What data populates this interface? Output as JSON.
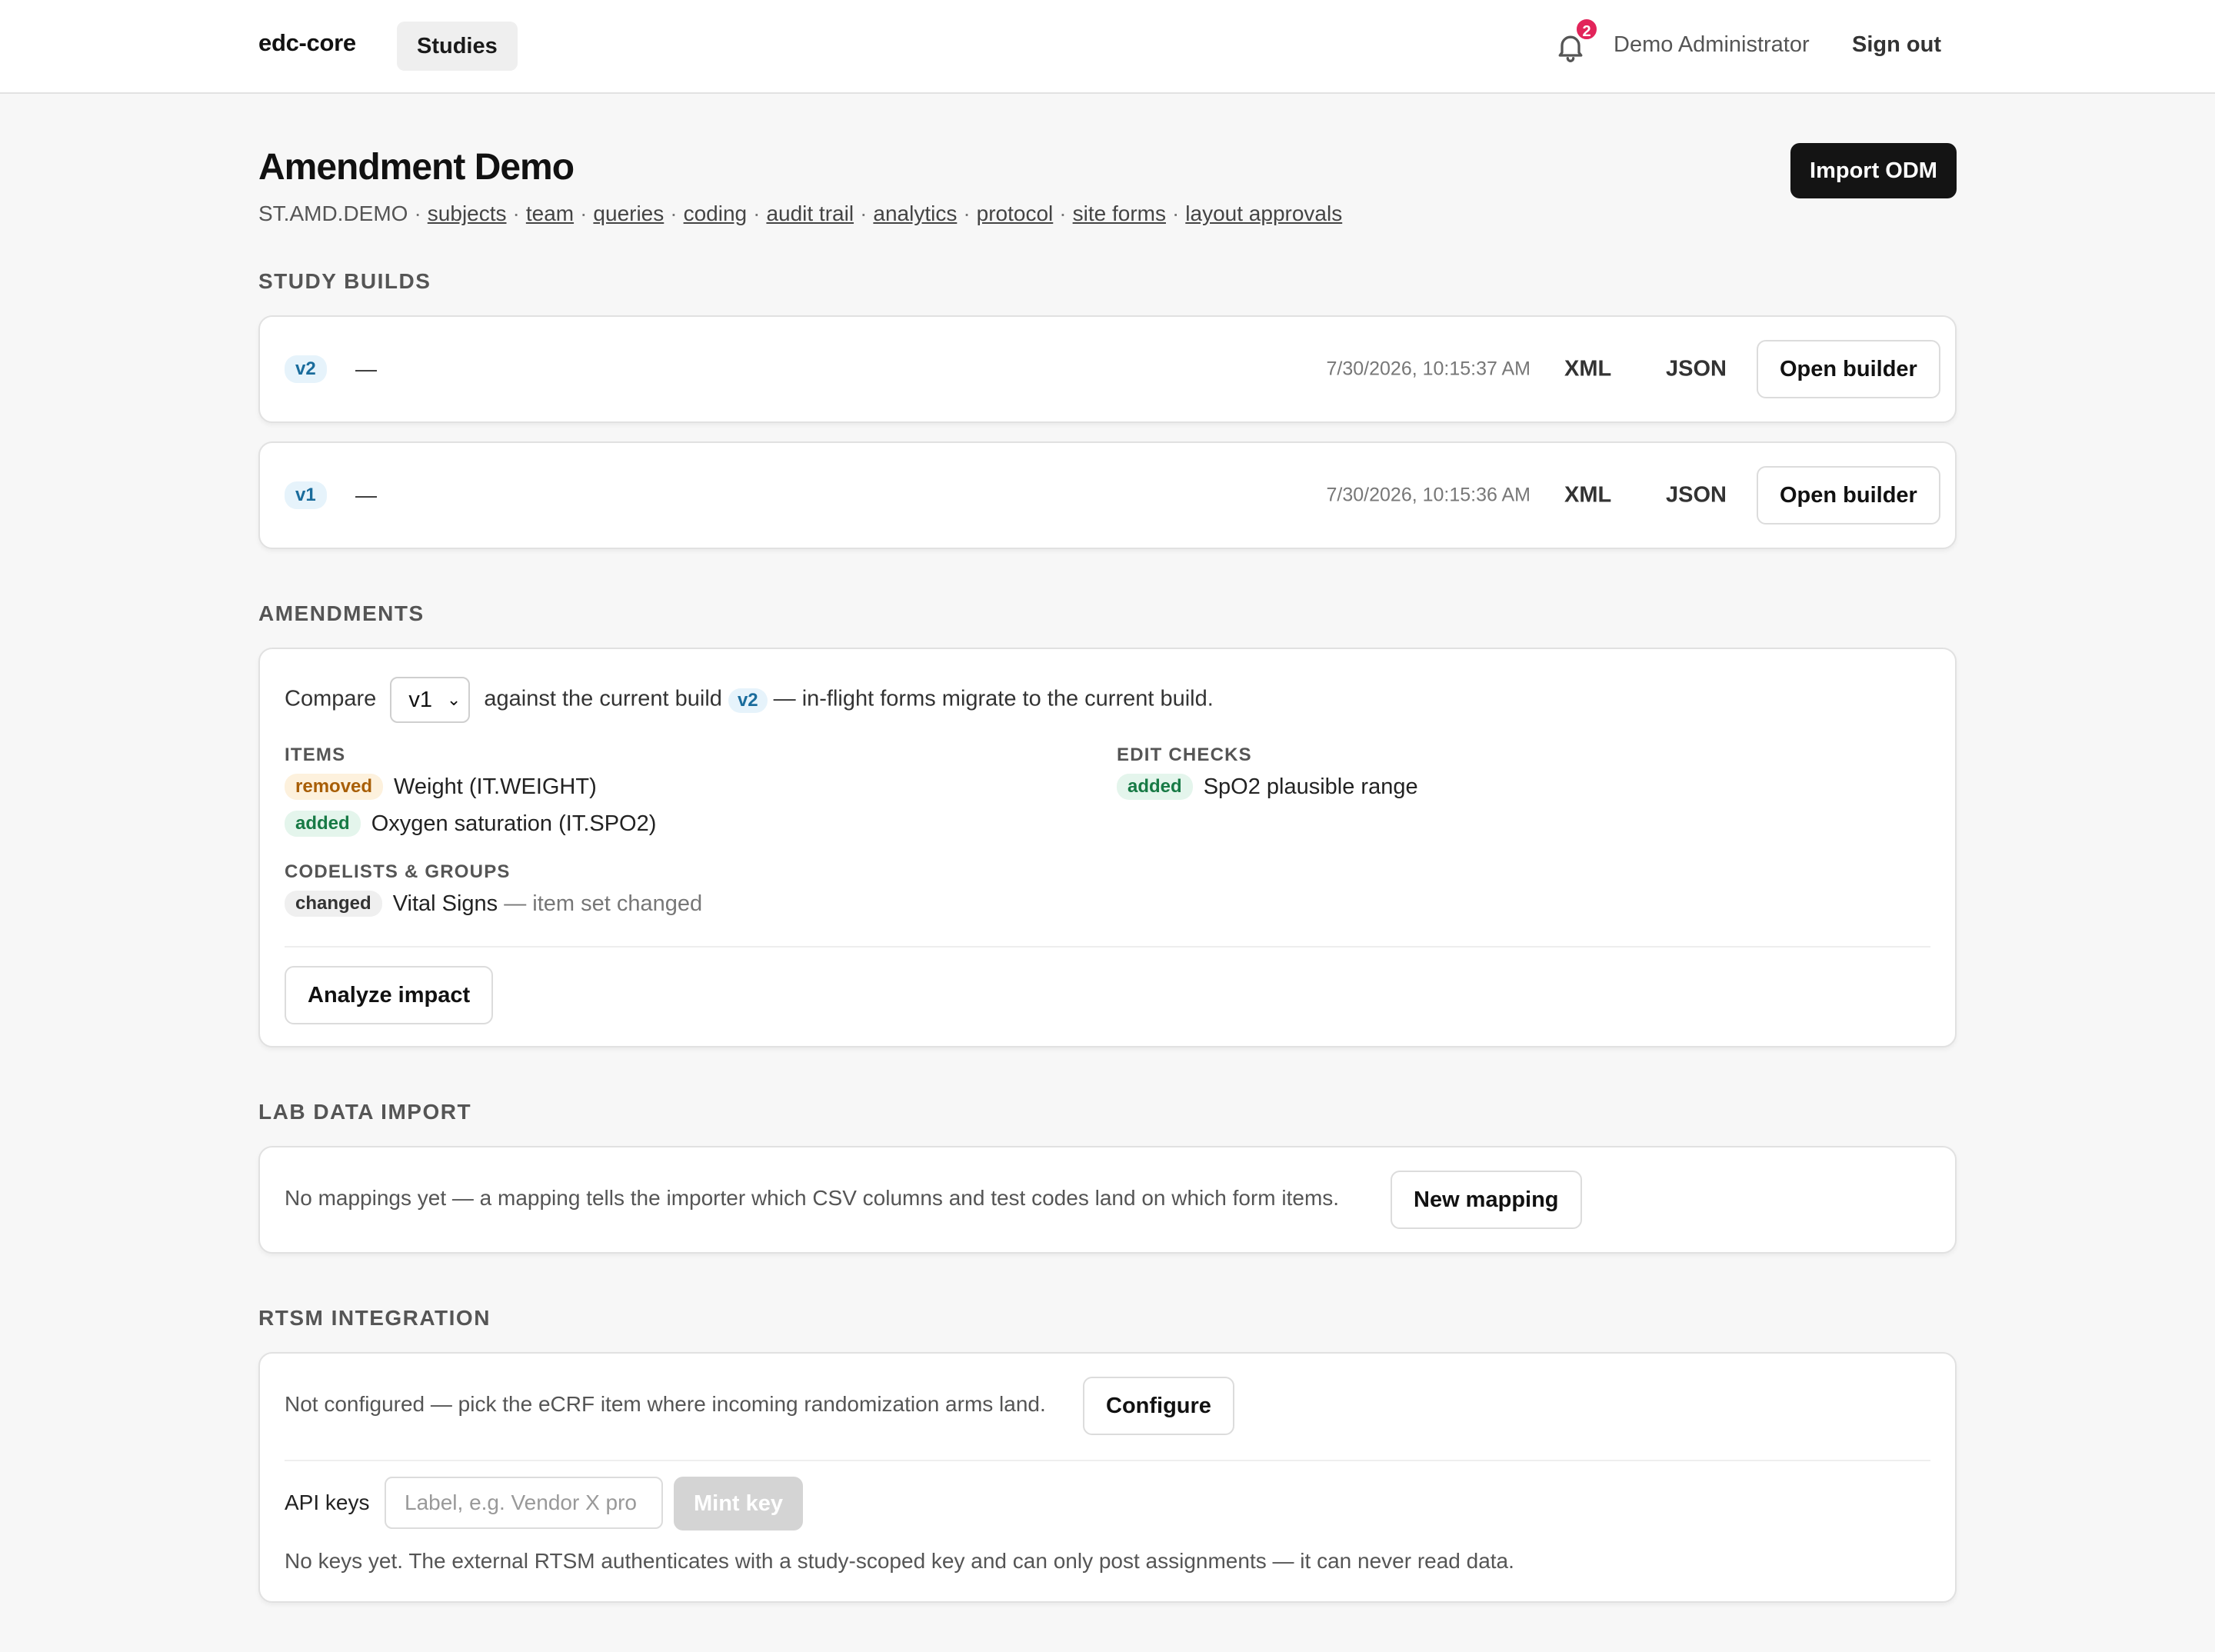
{
  "topbar": {
    "brand": "edc-core",
    "nav_studies": "Studies",
    "notification_count": "2",
    "user_name": "Demo Administrator",
    "sign_out": "Sign out"
  },
  "study": {
    "title": "Amendment Demo",
    "code": "ST.AMD.DEMO",
    "links": [
      "subjects",
      "team",
      "queries",
      "coding",
      "audit trail",
      "analytics",
      "protocol",
      "site forms",
      "layout approvals"
    ],
    "import_button": "Import ODM"
  },
  "builds": {
    "section_title": "STUDY BUILDS",
    "rows": [
      {
        "version": "v2",
        "description": "—",
        "timestamp": "7/30/2026, 10:15:37 AM",
        "xml": "XML",
        "json": "JSON",
        "open": "Open builder"
      },
      {
        "version": "v1",
        "description": "—",
        "timestamp": "7/30/2026, 10:15:36 AM",
        "xml": "XML",
        "json": "JSON",
        "open": "Open builder"
      }
    ]
  },
  "amendments": {
    "section_title": "AMENDMENTS",
    "compare_label": "Compare",
    "compare_value": "v1",
    "against_text": "against the current build",
    "current_build": "v2",
    "migrate_text": "— in-flight forms migrate to the current build.",
    "items_head": "ITEMS",
    "items": [
      {
        "tag": "removed",
        "text": "Weight (IT.WEIGHT)"
      },
      {
        "tag": "added",
        "text": "Oxygen saturation (IT.SPO2)"
      }
    ],
    "edit_checks_head": "EDIT CHECKS",
    "edit_checks": [
      {
        "tag": "added",
        "text": "SpO2 plausible range"
      }
    ],
    "codelists_head": "CODELISTS & GROUPS",
    "codelists": [
      {
        "tag": "changed",
        "text": "Vital Signs",
        "note": "— item set changed"
      }
    ],
    "analyze_button": "Analyze impact"
  },
  "lab": {
    "section_title": "LAB DATA IMPORT",
    "empty_text": "No mappings yet — a mapping tells the importer which CSV columns and test codes land on which form items.",
    "new_mapping_button": "New mapping"
  },
  "rtsm": {
    "section_title": "RTSM INTEGRATION",
    "status_text": "Not configured — pick the eCRF item where incoming randomization arms land.",
    "configure_button": "Configure",
    "api_keys_label": "API keys",
    "key_input_placeholder": "Label, e.g. Vendor X pro",
    "mint_button": "Mint key",
    "no_keys_text": "No keys yet. The external RTSM authenticates with a study-scoped key and can only post assignments — it can never read data."
  }
}
